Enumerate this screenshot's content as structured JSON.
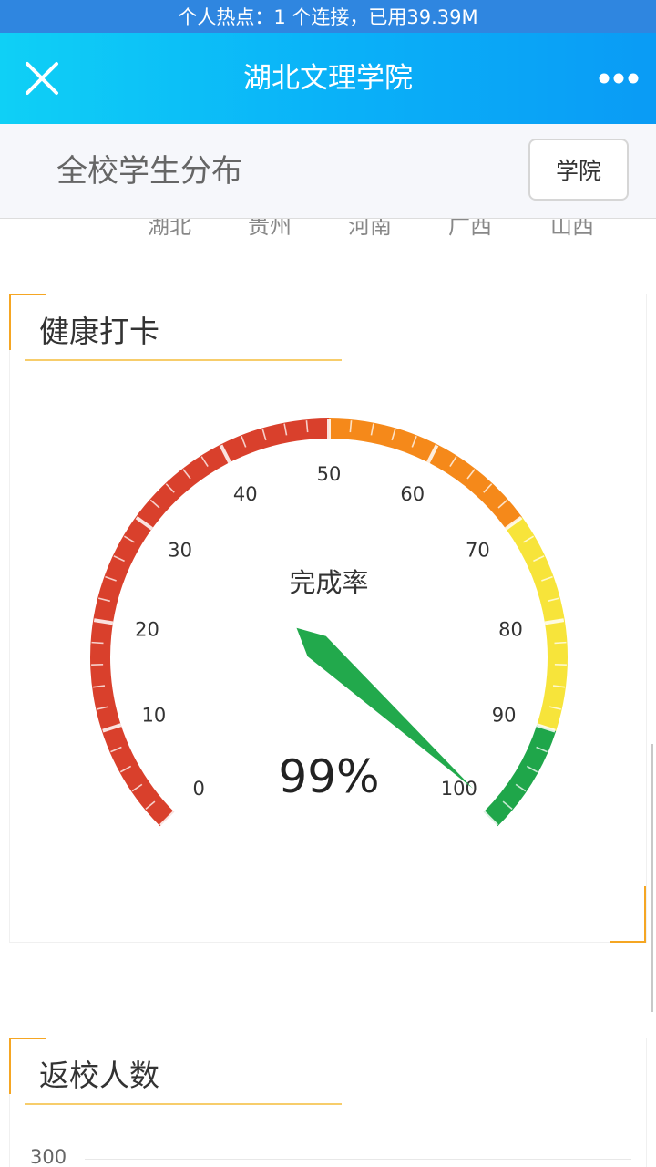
{
  "status_bar": {
    "text": "个人热点：1 个连接，已用39.39M"
  },
  "nav": {
    "title": "湖北文理学院",
    "close_icon": "close-icon",
    "more_icon": "more-icon"
  },
  "sub_header": {
    "title": "全校学生分布",
    "college_button": "学院"
  },
  "provinces": [
    "湖北",
    "贵州",
    "河南",
    "广西",
    "山西"
  ],
  "health_card": {
    "title": "健康打卡",
    "gauge": {
      "min": 0,
      "max": 100,
      "value": 99,
      "label": "完成率",
      "value_text": "99%",
      "ticks": [
        "0",
        "10",
        "20",
        "30",
        "40",
        "50",
        "60",
        "70",
        "80",
        "90",
        "100"
      ],
      "colors": {
        "red": "#d9402c",
        "orange": "#f5891a",
        "yellow": "#f7e43a",
        "green": "#1fa64a"
      },
      "bands": [
        {
          "from": 0,
          "to": 50,
          "color": "#d9402c"
        },
        {
          "from": 50,
          "to": 70,
          "color": "#f5891a"
        },
        {
          "from": 70,
          "to": 90,
          "color": "#f7e43a"
        },
        {
          "from": 90,
          "to": 100,
          "color": "#1fa64a"
        }
      ],
      "pointer_color": "#22a94c"
    }
  },
  "return_card": {
    "title": "返校人数",
    "y_first_tick": "300"
  },
  "colors": {
    "accent": "#f5a623",
    "nav_start": "#0fd0f6",
    "nav_end": "#0a9bf5",
    "status_bg": "#2f86e0"
  }
}
